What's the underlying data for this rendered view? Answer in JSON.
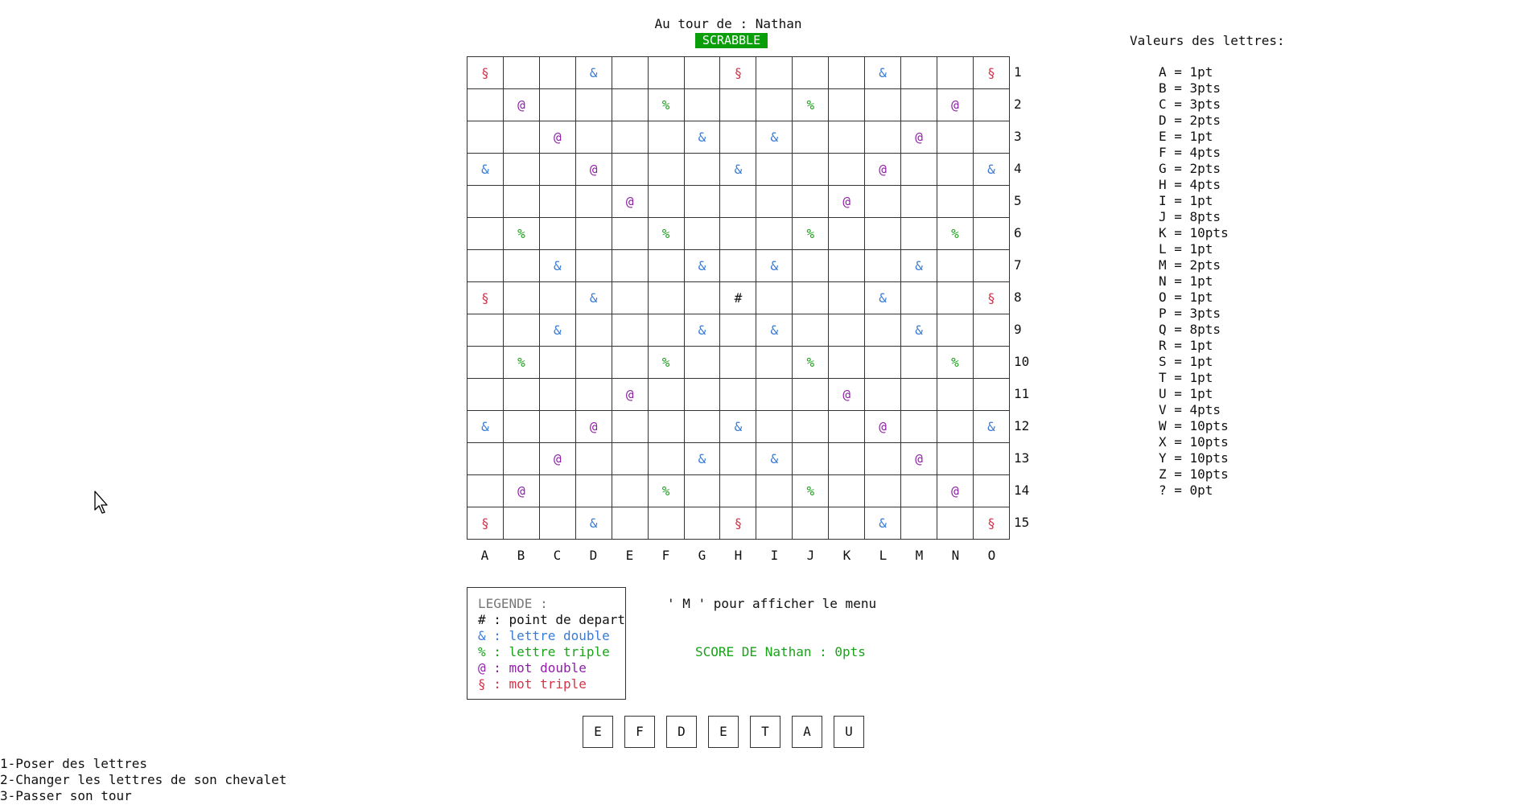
{
  "header": {
    "turn_label": "Au tour de : Nathan",
    "title": "SCRABBLE"
  },
  "board": {
    "rows": [
      [
        "§",
        "",
        "",
        "&",
        "",
        "",
        "",
        "§",
        "",
        "",
        "",
        "&",
        "",
        "",
        "§"
      ],
      [
        "",
        "@",
        "",
        "",
        "",
        "%",
        "",
        "",
        "",
        "%",
        "",
        "",
        "",
        "@",
        ""
      ],
      [
        "",
        "",
        "@",
        "",
        "",
        "",
        "&",
        "",
        "&",
        "",
        "",
        "",
        "@",
        "",
        ""
      ],
      [
        "&",
        "",
        "",
        "@",
        "",
        "",
        "",
        "&",
        "",
        "",
        "",
        "@",
        "",
        "",
        "&"
      ],
      [
        "",
        "",
        "",
        "",
        "@",
        "",
        "",
        "",
        "",
        "",
        "@",
        "",
        "",
        "",
        ""
      ],
      [
        "",
        "%",
        "",
        "",
        "",
        "%",
        "",
        "",
        "",
        "%",
        "",
        "",
        "",
        "%",
        ""
      ],
      [
        "",
        "",
        "&",
        "",
        "",
        "",
        "&",
        "",
        "&",
        "",
        "",
        "",
        "&",
        "",
        ""
      ],
      [
        "§",
        "",
        "",
        "&",
        "",
        "",
        "",
        "#",
        "",
        "",
        "",
        "&",
        "",
        "",
        "§"
      ],
      [
        "",
        "",
        "&",
        "",
        "",
        "",
        "&",
        "",
        "&",
        "",
        "",
        "",
        "&",
        "",
        ""
      ],
      [
        "",
        "%",
        "",
        "",
        "",
        "%",
        "",
        "",
        "",
        "%",
        "",
        "",
        "",
        "%",
        ""
      ],
      [
        "",
        "",
        "",
        "",
        "@",
        "",
        "",
        "",
        "",
        "",
        "@",
        "",
        "",
        "",
        ""
      ],
      [
        "&",
        "",
        "",
        "@",
        "",
        "",
        "",
        "&",
        "",
        "",
        "",
        "@",
        "",
        "",
        "&"
      ],
      [
        "",
        "",
        "@",
        "",
        "",
        "",
        "&",
        "",
        "&",
        "",
        "",
        "",
        "@",
        "",
        ""
      ],
      [
        "",
        "@",
        "",
        "",
        "",
        "%",
        "",
        "",
        "",
        "%",
        "",
        "",
        "",
        "@",
        ""
      ],
      [
        "§",
        "",
        "",
        "&",
        "",
        "",
        "",
        "§",
        "",
        "",
        "",
        "&",
        "",
        "",
        "§"
      ]
    ],
    "row_labels": [
      "1",
      "2",
      "3",
      "4",
      "5",
      "6",
      "7",
      "8",
      "9",
      "10",
      "11",
      "12",
      "13",
      "14",
      "15"
    ],
    "col_labels": [
      "A",
      "B",
      "C",
      "D",
      "E",
      "F",
      "G",
      "H",
      "I",
      "J",
      "K",
      "L",
      "M",
      "N",
      "O"
    ]
  },
  "legend": {
    "title": "LEGENDE :",
    "start": "# : point de depart",
    "double_letter": "& : lettre double",
    "triple_letter": "% : lettre triple",
    "double_word": "@ : mot double",
    "triple_word": "§ : mot triple"
  },
  "menu_hint": "' M ' pour afficher le menu",
  "score": "SCORE DE Nathan : 0pts",
  "rack": [
    "E",
    "F",
    "D",
    "E",
    "T",
    "A",
    "U"
  ],
  "letter_values": {
    "title": "Valeurs des lettres:",
    "items": [
      "A = 1pt",
      "B = 3pts",
      "C = 3pts",
      "D = 2pts",
      "E = 1pt",
      "F = 4pts",
      "G = 2pts",
      "H = 4pts",
      "I = 1pt",
      "J = 8pts",
      "K = 10pts",
      "L = 1pt",
      "M = 2pts",
      "N = 1pt",
      "O = 1pt",
      "P = 3pts",
      "Q = 8pts",
      "R = 1pt",
      "S = 1pt",
      "T = 1pt",
      "U = 1pt",
      "V = 4pts",
      "W = 10pts",
      "X = 10pts",
      "Y = 10pts",
      "Z = 10pts",
      "? = 0pt"
    ]
  },
  "options": [
    "1-Poser des lettres",
    "2-Changer les lettres de son chevalet",
    "3-Passer son tour"
  ],
  "colors": {
    "title_banner": "#0a9e0a",
    "double_letter": "#3a7bd5",
    "triple_letter": "#1aa31a",
    "double_word": "#8e1ea8",
    "triple_word": "#d6334a",
    "score": "#1aa31a"
  },
  "icons": {
    "cursor": "mouse-pointer-icon"
  }
}
